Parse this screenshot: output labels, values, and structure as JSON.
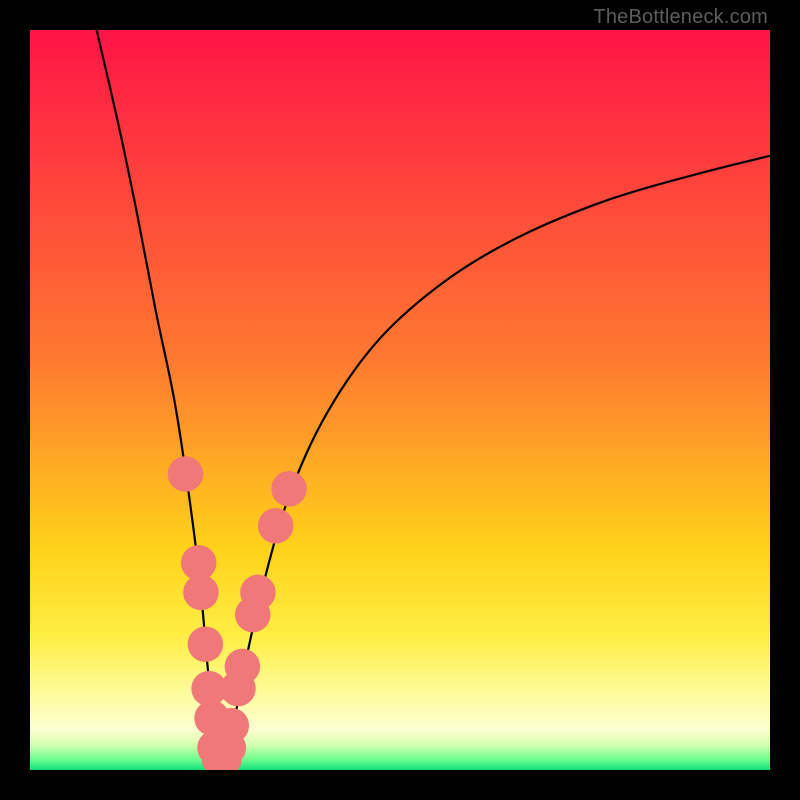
{
  "attribution": "TheBottleneck.com",
  "chart_data": {
    "type": "line",
    "title": "",
    "xlabel": "",
    "ylabel": "",
    "xlim": [
      0,
      100
    ],
    "ylim": [
      0,
      100
    ],
    "background_gradient_stops": [
      {
        "pct": 0.0,
        "color": "#ff1446"
      },
      {
        "pct": 0.45,
        "color": "#ff7a30"
      },
      {
        "pct": 0.7,
        "color": "#ffd21a"
      },
      {
        "pct": 0.82,
        "color": "#ffee44"
      },
      {
        "pct": 0.9,
        "color": "#fffba0"
      },
      {
        "pct": 0.945,
        "color": "#fdffd0"
      },
      {
        "pct": 0.965,
        "color": "#d7ffb0"
      },
      {
        "pct": 0.985,
        "color": "#70ff90"
      },
      {
        "pct": 1.0,
        "color": "#10e078"
      }
    ],
    "series": [
      {
        "name": "left-curve",
        "color": "#000000",
        "x": [
          9.0,
          12.0,
          14.5,
          17.0,
          19.5,
          21.5,
          23.0,
          24.0,
          24.8,
          25.2
        ],
        "y": [
          100,
          87,
          75,
          62,
          50,
          37,
          25,
          14,
          6,
          1
        ]
      },
      {
        "name": "right-curve",
        "color": "#000000",
        "x": [
          26.5,
          27.5,
          29.0,
          31.5,
          35.0,
          40.0,
          47.0,
          56.0,
          66.0,
          78.0,
          90.0,
          100.0
        ],
        "y": [
          1,
          6,
          14,
          25,
          37,
          48,
          58,
          66,
          72,
          77,
          80.5,
          83
        ]
      }
    ],
    "markers": {
      "color": "#f07878",
      "radius": 2.4,
      "points": [
        {
          "x": 21.0,
          "y": 40
        },
        {
          "x": 22.8,
          "y": 28
        },
        {
          "x": 23.1,
          "y": 24
        },
        {
          "x": 23.7,
          "y": 17
        },
        {
          "x": 24.2,
          "y": 11
        },
        {
          "x": 24.6,
          "y": 7
        },
        {
          "x": 25.0,
          "y": 3
        },
        {
          "x": 25.6,
          "y": 1.5
        },
        {
          "x": 26.2,
          "y": 1.5
        },
        {
          "x": 26.8,
          "y": 3
        },
        {
          "x": 27.2,
          "y": 6
        },
        {
          "x": 28.1,
          "y": 11
        },
        {
          "x": 28.7,
          "y": 14
        },
        {
          "x": 30.1,
          "y": 21
        },
        {
          "x": 30.8,
          "y": 24
        },
        {
          "x": 33.2,
          "y": 33
        },
        {
          "x": 35.0,
          "y": 38
        }
      ]
    }
  }
}
